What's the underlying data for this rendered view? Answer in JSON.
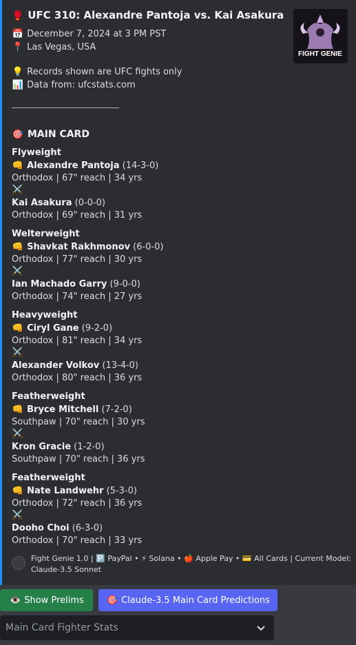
{
  "event": {
    "title_icon": "boxing-glove-icon",
    "title": "UFC 310: Alexandre Pantoja vs. Kai Asakura",
    "date": "December 7, 2024 at 3 PM PST",
    "location": "Las Vegas, USA",
    "note": "Records shown are UFC fights only",
    "source": "Data from: ufcstats.com",
    "separator": "________________________",
    "main_card_label": "MAIN CARD",
    "logo_text": "FIGHT GENIE"
  },
  "bouts": [
    {
      "weight_class": "Flyweight",
      "fighter1": {
        "name": "Alexandre Pantoja",
        "record": "(14-3-0)",
        "details": "Orthodox | 67\" reach | 34 yrs"
      },
      "fighter2": {
        "name": "Kai Asakura",
        "record": "(0-0-0)",
        "details": "Orthodox | 69\" reach | 31 yrs"
      }
    },
    {
      "weight_class": "Welterweight",
      "fighter1": {
        "name": "Shavkat Rakhmonov",
        "record": "(6-0-0)",
        "details": "Orthodox | 77\" reach | 30 yrs"
      },
      "fighter2": {
        "name": "Ian Machado Garry",
        "record": "(9-0-0)",
        "details": "Orthodox | 74\" reach | 27 yrs"
      }
    },
    {
      "weight_class": "Heavyweight",
      "fighter1": {
        "name": "Ciryl Gane",
        "record": "(9-2-0)",
        "details": "Orthodox | 81\" reach | 34 yrs"
      },
      "fighter2": {
        "name": "Alexander Volkov",
        "record": "(13-4-0)",
        "details": "Orthodox | 80\" reach | 36 yrs"
      }
    },
    {
      "weight_class": "Featherweight",
      "fighter1": {
        "name": "Bryce Mitchell",
        "record": "(7-2-0)",
        "details": "Southpaw | 70\" reach | 30 yrs"
      },
      "fighter2": {
        "name": "Kron Gracie",
        "record": "(1-2-0)",
        "details": "Southpaw | 70\" reach | 36 yrs"
      }
    },
    {
      "weight_class": "Featherweight",
      "fighter1": {
        "name": "Nate Landwehr",
        "record": "(5-3-0)",
        "details": "Orthodox | 72\" reach | 36 yrs"
      },
      "fighter2": {
        "name": "Dooho Choi",
        "record": "(6-3-0)",
        "details": "Orthodox | 70\" reach | 33 yrs"
      }
    }
  ],
  "footer": {
    "line1": "Fight Genie 1.0  |  🅿️ PayPal • ⚡ Solana • 🍎 Apple Pay • 💳 All Cards  |  Current Model:",
    "line2": "Claude-3.5 Sonnet"
  },
  "buttons": {
    "prelims": "Show Prelims",
    "predictions": "Claude-3.5 Main Card Predictions"
  },
  "select": {
    "value": "Main Card Fighter Stats"
  },
  "colors": {
    "accent_border": "#1e90ff",
    "green_button": "#248046",
    "blurple_button": "#5865f2"
  }
}
